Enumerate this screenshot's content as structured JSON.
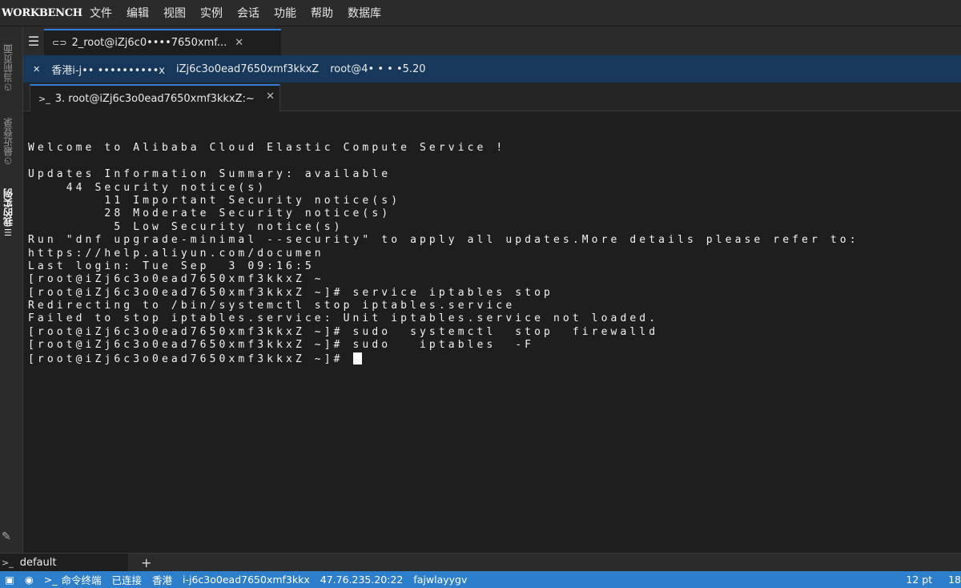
{
  "app": {
    "brand": "WORKBENCH"
  },
  "menu": [
    "文件",
    "编辑",
    "视图",
    "实例",
    "会话",
    "功能",
    "帮助",
    "数据库"
  ],
  "sidebar": {
    "items": [
      {
        "label": "当前页面",
        "icon": "clock-icon"
      },
      {
        "label": "最近登录",
        "icon": "clock-icon"
      },
      {
        "label": "我的实例",
        "icon": "list-icon"
      }
    ]
  },
  "tabs_primary": [
    {
      "label": "2_root@iZj6c0••••7650xmf..."
    }
  ],
  "session": {
    "region": "香港i-j•• ••••••••••x",
    "instance": "iZj6c3o0ead7650xmf3kkxZ",
    "user_host": "root@4• • • •5.20"
  },
  "tabs_secondary": [
    {
      "label": "3. root@iZj6c3o0ead7650xmf3kkxZ:~"
    }
  ],
  "terminal": {
    "lines": [
      "",
      "Welcome to Alibaba Cloud Elastic Compute Service !",
      "",
      "Updates Information Summary: available",
      "    44 Security notice(s)",
      "        11 Important Security notice(s)",
      "        28 Moderate Security notice(s)",
      "         5 Low Security notice(s)",
      "Run \"dnf upgrade-minimal --security\" to apply all updates.More details please refer to:",
      "https://help.aliyun.com/documen",
      "Last login: Tue Sep  3 09:16:5",
      "[root@iZj6c3o0ead7650xmf3kkxZ ~",
      "[root@iZj6c3o0ead7650xmf3kkxZ ~]# service iptables stop",
      "Redirecting to /bin/systemctl stop iptables.service",
      "Failed to stop iptables.service: Unit iptables.service not loaded.",
      "[root@iZj6c3o0ead7650xmf3kkxZ ~]# sudo  systemctl  stop  firewalld",
      "[root@iZj6c3o0ead7650xmf3kkxZ ~]# sudo   iptables  -F"
    ],
    "prompt": "[root@iZj6c3o0ead7650xmf3kkxZ ~]# "
  },
  "bottom_tabs": [
    {
      "label": "default"
    }
  ],
  "bottom_add": "+",
  "status": {
    "mode": "命令终端",
    "connection": "已连接",
    "region": "香港",
    "instance_id": "i-j6c3o0ead7650xmf3kkx",
    "address": "47.76.235.20:22",
    "user": "fajwlayygv",
    "font_size": "12 pt",
    "extra": "18"
  },
  "colors": {
    "accent": "#2f7ed8",
    "status_bar": "#2d7fcb",
    "session_bar": "#17385a"
  }
}
